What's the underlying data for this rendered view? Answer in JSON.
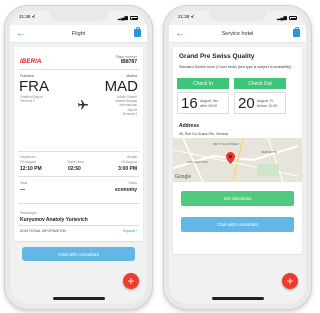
{
  "colors": {
    "accent_blue": "#2b95d9",
    "chat_blue": "#61b8e6",
    "green": "#3fc57a",
    "fab_red": "#ee3b2b",
    "iberia_red": "#d71920"
  },
  "flight_screen": {
    "status_time": "21:38 ⊀",
    "title": "Flight",
    "airline": "IBERIA",
    "flight_number_label": "Flight number",
    "flight_number": "IB8787",
    "origin": {
      "city": "Frankfurt",
      "code": "FRA",
      "airport": "Frankfurt Airport",
      "terminal": "Terminal 2"
    },
    "destination": {
      "city": "Madrid",
      "code": "MAD",
      "airport_lines": [
        "Adolfo Suárez",
        "Madrid-Barajas",
        "International",
        "Airport"
      ],
      "terminal": "Terminal 4"
    },
    "departure": {
      "label": "Departure",
      "date": "09 August",
      "time": "12:10 PM"
    },
    "travel_time": {
      "label": "Travel time",
      "value": "02:50"
    },
    "arrival": {
      "label": "Arrival",
      "date": "09 August",
      "time": "3:00 PM"
    },
    "seat": {
      "label": "Seat",
      "value": "—"
    },
    "class": {
      "label": "Class",
      "value": "economy"
    },
    "passenger": {
      "label": "Passenger",
      "name": "Kuryumov Anatoly Yurievich"
    },
    "additional_info": "ADDITIONAL INFORMATION",
    "expand_label": "Expand ›",
    "chat_button": "Chat with consultant",
    "fab_icon": "plus-icon"
  },
  "hotel_screen": {
    "status_time": "21:38 ⊀",
    "title": "Service hotel",
    "hotel_name": "Grand Pre Swiss Quality",
    "room_description": "Standard Double room (2 twin beds) (bed type is subject to availability)",
    "check_in": {
      "label": "Check In",
      "day": "16",
      "month": "August, Mo",
      "time": "after 09:00"
    },
    "check_out": {
      "label": "Check Out",
      "day": "20",
      "month": "August, Fr",
      "time": "before 12:00"
    },
    "address_label": "Address",
    "address": "36, Rue Du Grand-Pre, Geneva",
    "map_labels": [
      "PETIT-SACONNEX",
      "SERVETTE",
      "LES GROTTES"
    ],
    "google": "Google",
    "directions_button": "Get directions",
    "chat_button": "Chat with consultant",
    "fab_icon": "plus-icon"
  }
}
